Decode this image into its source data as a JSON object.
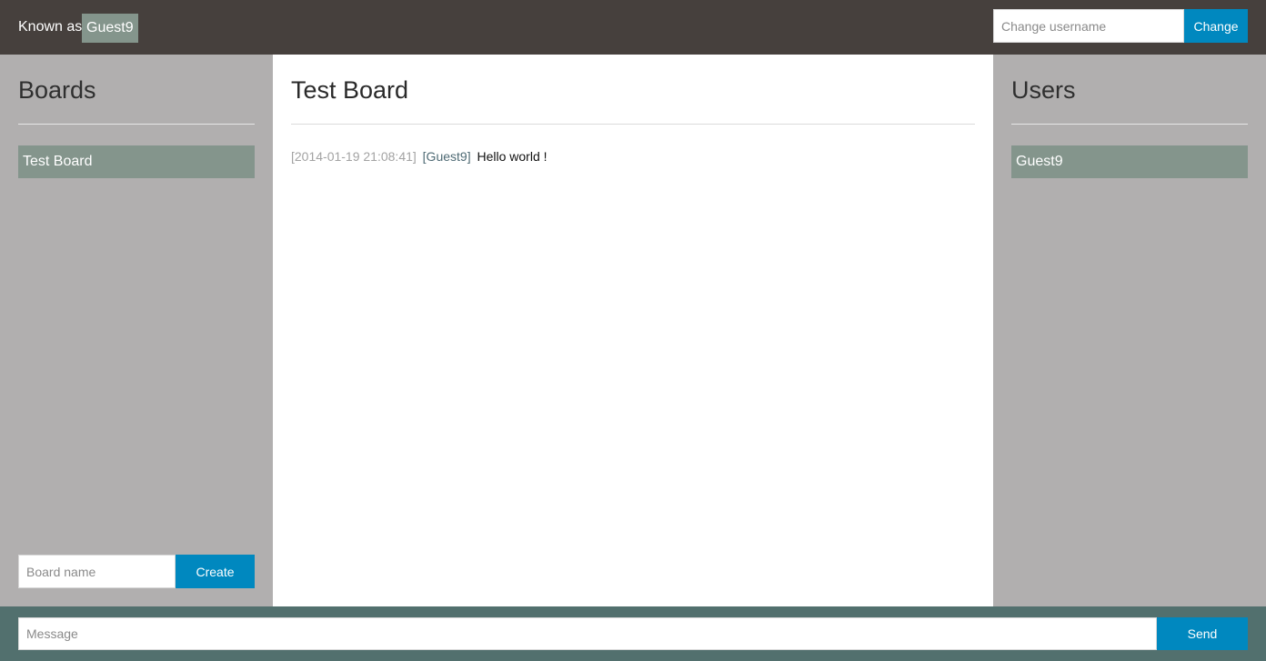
{
  "header": {
    "known_as_label": "Known as :",
    "current_username": "Guest9",
    "username_placeholder": "Change username",
    "username_value": "",
    "change_label": "Change"
  },
  "boards_panel": {
    "title": "Boards",
    "items": [
      {
        "label": "Test Board"
      }
    ],
    "board_name_placeholder": "Board name",
    "board_name_value": "",
    "create_label": "Create"
  },
  "board": {
    "title": "Test Board",
    "messages": [
      {
        "timestamp": "[2014-01-19 21:08:41]",
        "user": "[Guest9]",
        "text": "Hello world !"
      }
    ]
  },
  "users_panel": {
    "title": "Users",
    "items": [
      {
        "label": "Guest9"
      }
    ]
  },
  "composer": {
    "message_placeholder": "Message",
    "message_value": "",
    "send_label": "Send"
  },
  "colors": {
    "topbar": "#46403d",
    "side_panel": "#b1afaf",
    "accent_button": "#0088bf",
    "selected_item": "#84958c",
    "bottombar": "#52706e"
  }
}
